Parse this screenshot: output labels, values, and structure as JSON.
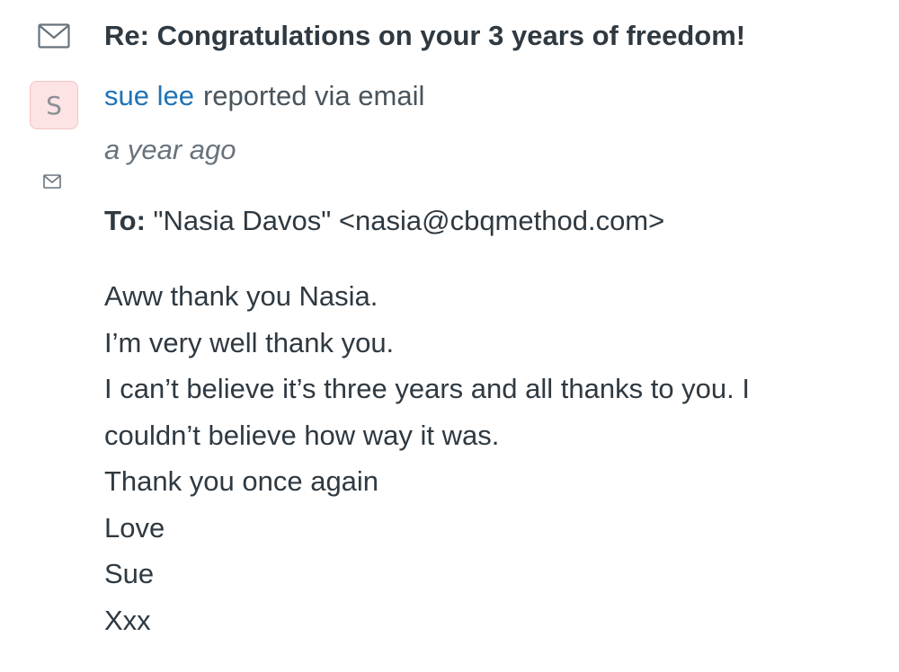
{
  "ticket": {
    "subject": "Re: Congratulations on your 3 years of freedom!",
    "author_initial": "S",
    "author_name": "sue lee",
    "reported_via": "reported via email",
    "timestamp": "a year ago",
    "to_label": "To:",
    "to_value": "\"Nasia Davos\" <nasia@cbqmethod.com>",
    "body_lines": [
      "Aww thank you Nasia.",
      "I’m very well thank you.",
      "I can’t believe it’s three years and all thanks to you. I",
      "couldn’t believe how way it was.",
      "Thank you once again",
      "Love",
      "Sue",
      "Xxx"
    ]
  },
  "icons": {
    "channel": "envelope-icon",
    "message_channel": "envelope-icon"
  },
  "colors": {
    "author_link": "#1f73b7",
    "avatar_bg": "#fde3e3",
    "text": "#2f3941",
    "muted": "#68737d"
  }
}
